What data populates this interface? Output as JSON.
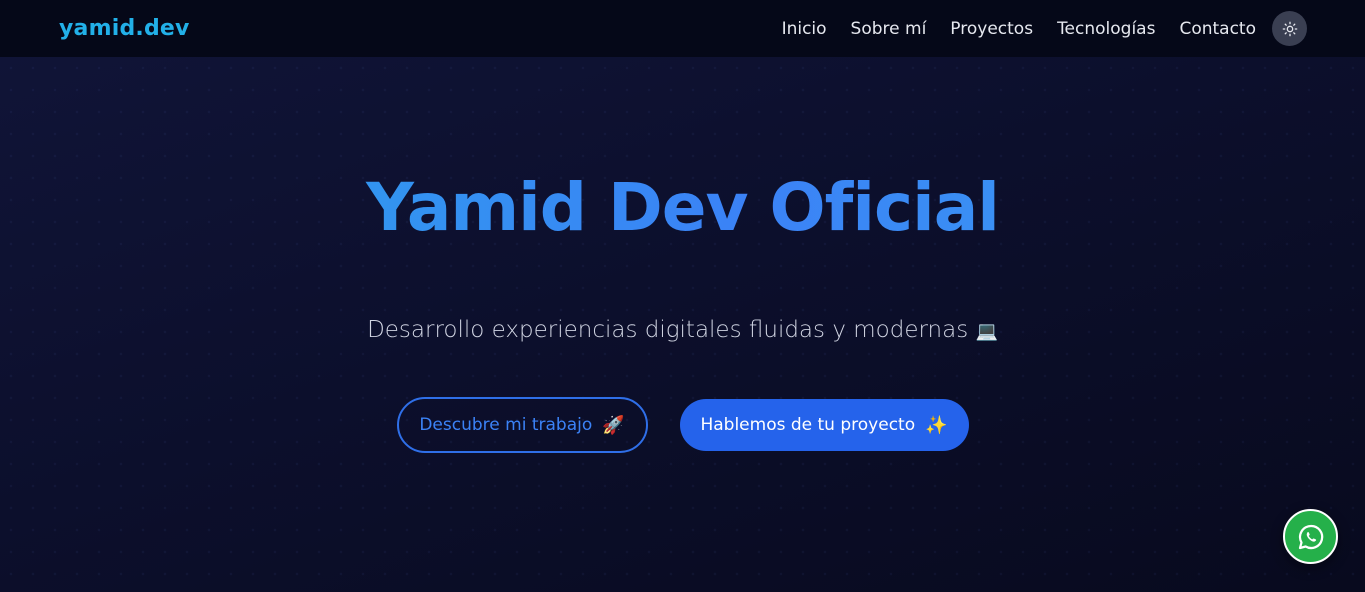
{
  "header": {
    "brand": "yamid.dev",
    "nav": [
      "Inicio",
      "Sobre mí",
      "Proyectos",
      "Tecnologías",
      "Contacto"
    ],
    "theme_toggle_icon": "sun-icon"
  },
  "hero": {
    "title": "Yamid Dev Oficial",
    "subtitle": "Desarrollo experiencias digitales fluidas y modernas",
    "subtitle_emoji": "💻",
    "primary_cta": {
      "label": "Descubre mi trabajo",
      "emoji": "🚀"
    },
    "secondary_cta": {
      "label": "Hablemos de tu proyecto",
      "emoji": "✨"
    }
  },
  "floating": {
    "whatsapp_icon": "whatsapp-icon"
  },
  "colors": {
    "accent": "#3b82f6",
    "brand": "#22b0e8",
    "cta_solid": "#2563eb",
    "whatsapp": "#25b04a",
    "navbar_bg": "#050818"
  }
}
